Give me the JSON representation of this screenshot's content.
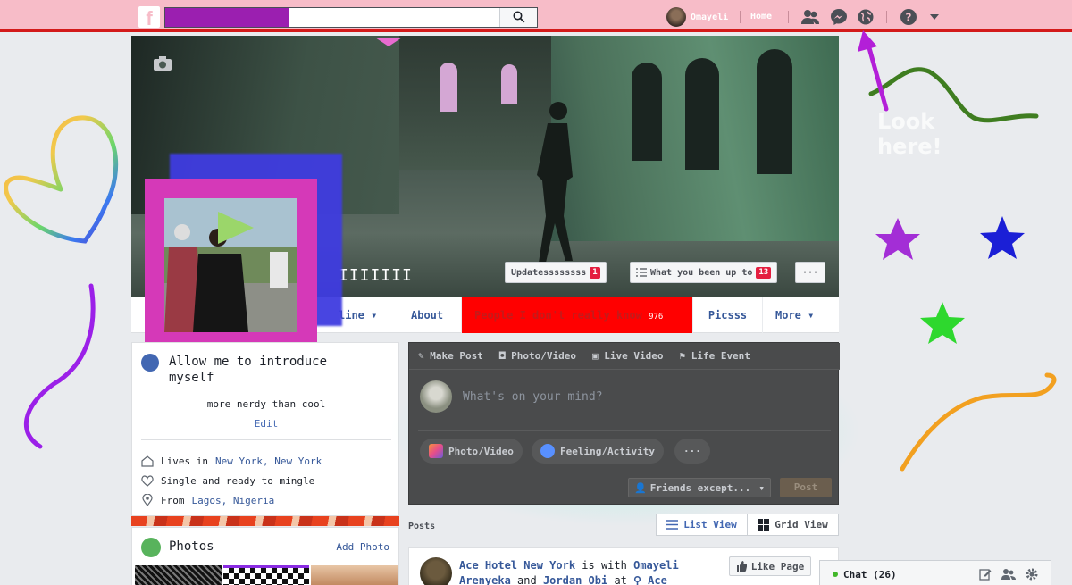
{
  "topbar": {
    "profile_name": "Omayeli",
    "home_label": "Home"
  },
  "cover": {
    "name_text": "IIIIIII",
    "updates_label": "Updatessssssss",
    "updates_count": "1",
    "activity_label": "What you been up to",
    "activity_count": "13",
    "more_dots": "···"
  },
  "nav": {
    "timeline_label": "line",
    "about_label": "About",
    "people_label": "People I don't really know",
    "people_count": "976",
    "photos_label": "Picsss",
    "more_label": "More"
  },
  "intro": {
    "title": "Allow me to introduce myself",
    "bio": "more nerdy than cool",
    "edit_label": "Edit",
    "lives_prefix": "Lives in",
    "lives_place": "New York, New York",
    "relationship": "Single and ready to mingle",
    "from_prefix": "From",
    "from_place": "Lagos, Nigeria"
  },
  "photos": {
    "title": "Photos",
    "add_label": "Add Photo"
  },
  "composer": {
    "tab_make_post": "Make Post",
    "tab_photo_video": "Photo/Video",
    "tab_live_video": "Live Video",
    "tab_life_event": "Life Event",
    "placeholder": "What's on your mind?",
    "photo_video_pill": "Photo/Video",
    "feeling_pill": "Feeling/Activity",
    "more_pill": "···",
    "audience": "Friends except...",
    "post_label": "Post"
  },
  "posts": {
    "section_label": "Posts",
    "list_view": "List View",
    "grid_view": "Grid View",
    "post_author": "Ace Hotel New York",
    "post_with": "is with",
    "post_friend1": "Omayeli Arenyeka",
    "post_and": "and",
    "post_friend2": "Jordan Obi",
    "post_at": "at",
    "post_place": "Ace",
    "like_page": "Like Page"
  },
  "chat": {
    "label": "Chat (26)"
  },
  "decorations": {
    "look_here": "Look here!"
  },
  "colors": {
    "topbar_bg": "#f7bcc8",
    "topbar_border": "#d31a1a",
    "people_tab_bg": "#ff0000",
    "profile_frame": "#d539b8",
    "profile_back_square": "#3f3ce0",
    "search_fill": "#9b1fb0",
    "composer_glow": "#6ef0dc"
  },
  "icons": [
    "facebook-logo",
    "search-icon",
    "friends-icon",
    "messenger-icon",
    "globe-icon",
    "help-icon",
    "caret-down-icon",
    "camera-icon",
    "list-icon",
    "grid-icon",
    "pencil-icon",
    "home-icon",
    "heart-icon",
    "location-icon",
    "photos-icon",
    "emoji-icon",
    "video-icon",
    "flag-icon",
    "like-icon",
    "chat-compose-icon",
    "gear-icon"
  ]
}
